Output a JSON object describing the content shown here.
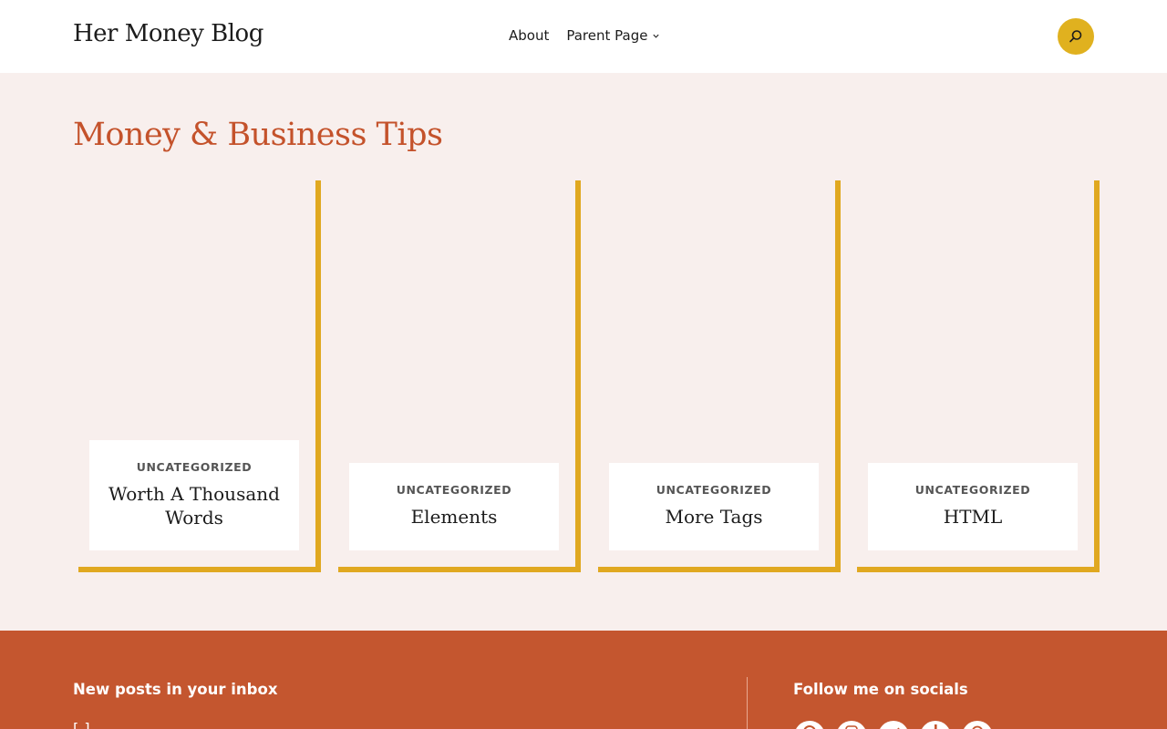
{
  "header": {
    "site_title": "Her Money Blog",
    "nav": [
      {
        "label": "About"
      },
      {
        "label": "Parent Page"
      }
    ],
    "search_icon": "search-icon"
  },
  "main": {
    "page_title": "Money & Business Tips",
    "posts": [
      {
        "category": "UNCATEGORIZED",
        "title": "Worth A Thousand Words"
      },
      {
        "category": "UNCATEGORIZED",
        "title": "Elements"
      },
      {
        "category": "UNCATEGORIZED",
        "title": "More Tags"
      },
      {
        "category": "UNCATEGORIZED",
        "title": "HTML"
      }
    ]
  },
  "footer": {
    "newsletter_heading": "New posts in your inbox",
    "newsletter_partial": "[                                                   ]",
    "socials_heading": "Follow me on socials",
    "social_icons": [
      "facebook-icon",
      "instagram-icon",
      "twitter-icon",
      "tiktok-icon",
      "pinterest-icon"
    ]
  },
  "colors": {
    "accent_title": "#c4522b",
    "card_border": "#e0a820",
    "search_button": "#e0b11f",
    "footer_bg": "#c4562f",
    "page_bg": "#f8efed"
  }
}
